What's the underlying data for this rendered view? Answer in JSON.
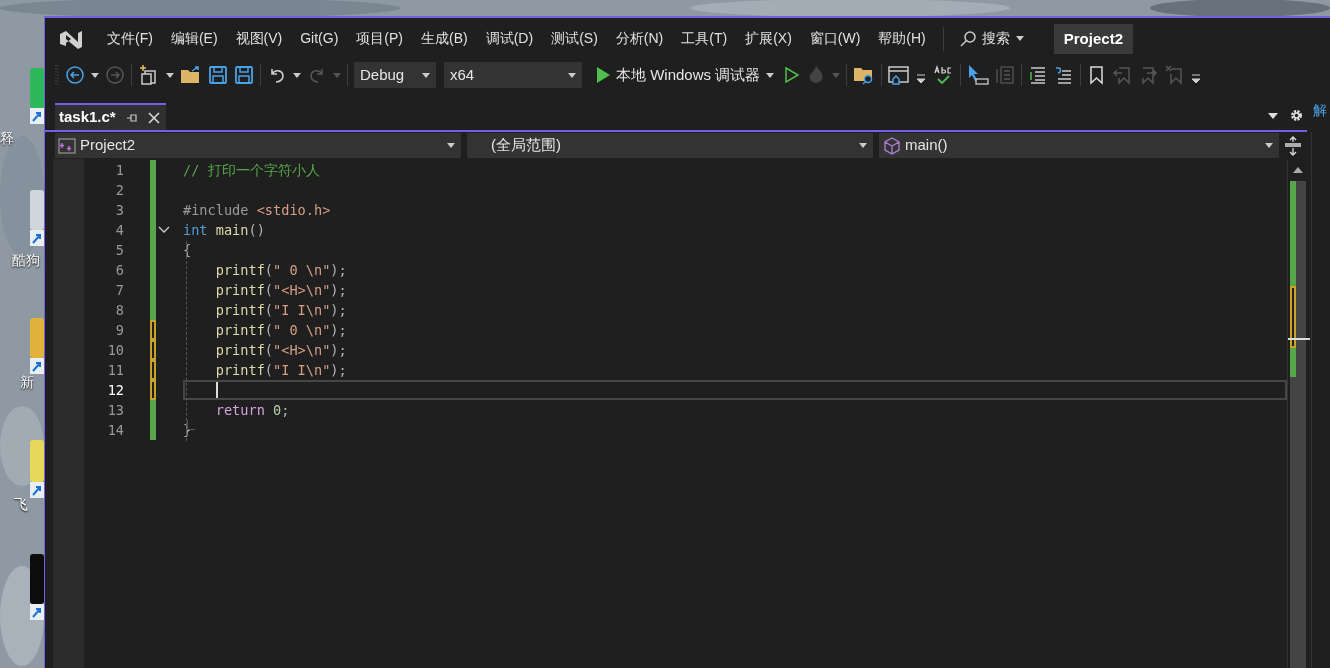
{
  "desktop": {
    "labels": [
      {
        "text": "释",
        "kind": "plain"
      },
      {
        "text": "酷狗",
        "kind": "plain"
      },
      {
        "text": "新",
        "kind": "plain"
      },
      {
        "text": "飞",
        "kind": "plain"
      }
    ]
  },
  "menu": [
    "文件(F)",
    "编辑(E)",
    "视图(V)",
    "Git(G)",
    "项目(P)",
    "生成(B)",
    "调试(D)",
    "测试(S)",
    "分析(N)",
    "工具(T)",
    "扩展(X)",
    "窗口(W)",
    "帮助(H)"
  ],
  "search": {
    "label": "搜索"
  },
  "solution_name": "Project2",
  "toolbar": {
    "configuration": "Debug",
    "platform": "x64",
    "run_label": "本地 Windows 调试器"
  },
  "tabs": [
    {
      "label": "task1.c*",
      "selected": true
    }
  ],
  "nav_bar": {
    "project": "Project2",
    "scope": "(全局范围)",
    "member": "main()"
  },
  "right_panel": {
    "title": "解"
  },
  "editor": {
    "lines": [
      {
        "number": "1",
        "unsaved": false,
        "current": false,
        "tokens": [
          {
            "kind": "comment",
            "text": "// 打印一个字符小人"
          }
        ]
      },
      {
        "number": "2",
        "unsaved": false,
        "current": false
      },
      {
        "number": "3",
        "unsaved": false,
        "current": false,
        "tokens": [
          {
            "kind": "preproc",
            "text": "#include "
          },
          {
            "kind": "string",
            "text": "<stdio.h>"
          }
        ]
      },
      {
        "number": "4",
        "unsaved": false,
        "current": false,
        "fold": {
          "expanded": true
        },
        "tokens": [
          {
            "kind": "keyword",
            "text": "int"
          },
          {
            "kind": "function",
            "text": " main"
          },
          {
            "kind": "punct",
            "text": "()"
          }
        ]
      },
      {
        "number": "5",
        "unsaved": false,
        "current": false,
        "tokens": [
          {
            "kind": "punct",
            "text": "{"
          }
        ]
      },
      {
        "number": "6",
        "unsaved": false,
        "current": false,
        "tokens": [
          {
            "kind": "function",
            "text": "    printf"
          },
          {
            "kind": "punct",
            "text": "("
          },
          {
            "kind": "string",
            "text": "\" 0 \\n\""
          },
          {
            "kind": "punct",
            "text": ");"
          }
        ]
      },
      {
        "number": "7",
        "unsaved": false,
        "current": false,
        "tokens": [
          {
            "kind": "function",
            "text": "    printf"
          },
          {
            "kind": "punct",
            "text": "("
          },
          {
            "kind": "string",
            "text": "\"<H>\\n\""
          },
          {
            "kind": "punct",
            "text": ");"
          }
        ]
      },
      {
        "number": "8",
        "unsaved": false,
        "current": false,
        "tokens": [
          {
            "kind": "function",
            "text": "    printf"
          },
          {
            "kind": "punct",
            "text": "("
          },
          {
            "kind": "string",
            "text": "\"I I\\n\""
          },
          {
            "kind": "punct",
            "text": ");"
          }
        ]
      },
      {
        "number": "9",
        "unsaved": true,
        "current": false,
        "tokens": [
          {
            "kind": "function",
            "text": "    printf"
          },
          {
            "kind": "punct",
            "text": "("
          },
          {
            "kind": "string",
            "text": "\" 0 \\n\""
          },
          {
            "kind": "punct",
            "text": ");"
          }
        ]
      },
      {
        "number": "10",
        "unsaved": true,
        "current": false,
        "tokens": [
          {
            "kind": "function",
            "text": "    printf"
          },
          {
            "kind": "punct",
            "text": "("
          },
          {
            "kind": "string",
            "text": "\"<H>\\n\""
          },
          {
            "kind": "punct",
            "text": ");"
          }
        ]
      },
      {
        "number": "11",
        "unsaved": true,
        "current": false,
        "tokens": [
          {
            "kind": "function",
            "text": "    printf"
          },
          {
            "kind": "punct",
            "text": "("
          },
          {
            "kind": "string",
            "text": "\"I I\\n\""
          },
          {
            "kind": "punct",
            "text": ");"
          }
        ]
      },
      {
        "number": "12",
        "unsaved": true,
        "current": true
      },
      {
        "number": "13",
        "unsaved": false,
        "current": false,
        "tokens": [
          {
            "kind": "keyword2",
            "text": "    return"
          },
          {
            "kind": "number",
            "text": " 0"
          },
          {
            "kind": "punct",
            "text": ";"
          }
        ]
      },
      {
        "number": "14",
        "unsaved": false,
        "current": false,
        "tokens": [
          {
            "kind": "punct",
            "text": "}"
          }
        ]
      }
    ]
  }
}
